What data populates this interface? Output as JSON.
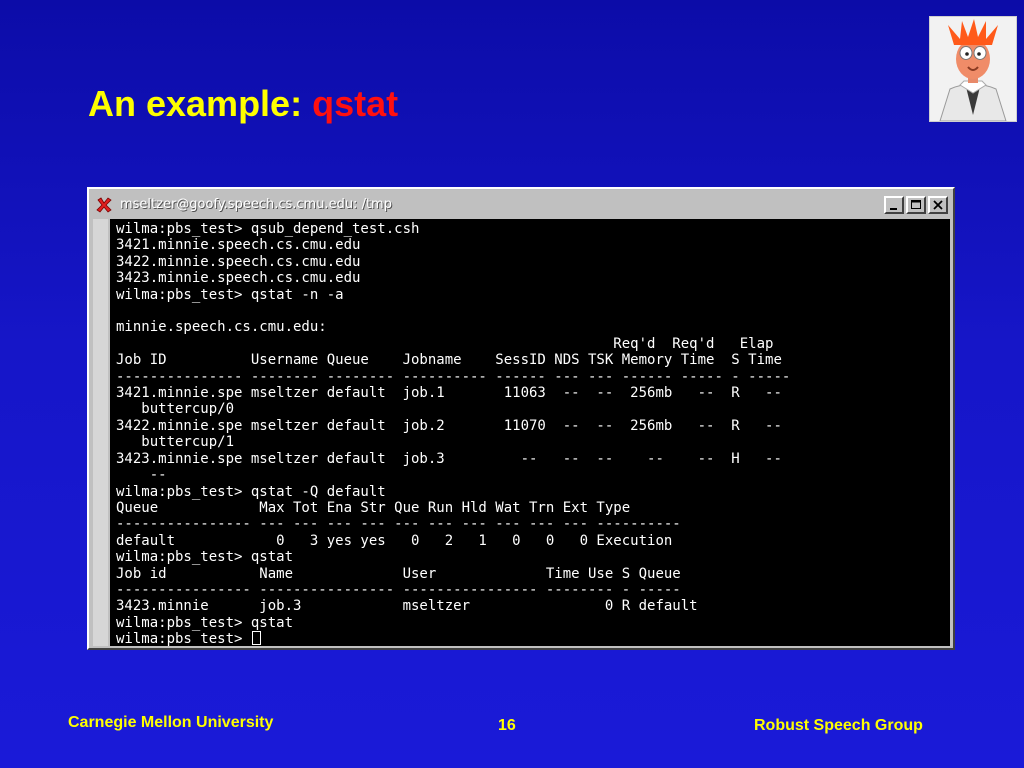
{
  "slide": {
    "title_prefix": "An example:",
    "title_command": "qstat"
  },
  "window": {
    "title": "mseltzer@goofy.speech.cs.cmu.edu: /tmp",
    "app_icon": "x-close-icon",
    "buttons": [
      "minimize-icon",
      "maximize-icon",
      "close-icon"
    ]
  },
  "terminal": {
    "lines": [
      "wilma:pbs_test> qsub_depend_test.csh",
      "3421.minnie.speech.cs.cmu.edu",
      "3422.minnie.speech.cs.cmu.edu",
      "3423.minnie.speech.cs.cmu.edu",
      "wilma:pbs_test> qstat -n -a",
      "",
      "minnie.speech.cs.cmu.edu:",
      "                                                           Req'd  Req'd   Elap",
      "Job ID          Username Queue    Jobname    SessID NDS TSK Memory Time  S Time",
      "--------------- -------- -------- ---------- ------ --- --- ------ ----- - -----",
      "3421.minnie.spe mseltzer default  job.1       11063  --  --  256mb   --  R   --",
      "   buttercup/0",
      "3422.minnie.spe mseltzer default  job.2       11070  --  --  256mb   --  R   --",
      "   buttercup/1",
      "3423.minnie.spe mseltzer default  job.3         --   --  --    --    --  H   --",
      "    --",
      "wilma:pbs_test> qstat -Q default",
      "Queue            Max Tot Ena Str Que Run Hld Wat Trn Ext Type",
      "---------------- --- --- --- --- --- --- --- --- --- --- ----------",
      "default            0   3 yes yes   0   2   1   0   0   0 Execution",
      "wilma:pbs_test> qstat",
      "Job id           Name             User             Time Use S Queue",
      "---------------- ---------------- ---------------- -------- - -----",
      "3423.minnie      job.3            mseltzer                0 R default",
      "wilma:pbs_test> qstat"
    ],
    "last_prompt": "wilma:pbs_test> "
  },
  "footer": {
    "left": "Carnegie Mellon University",
    "page": "16",
    "right": "Robust Speech Group"
  }
}
